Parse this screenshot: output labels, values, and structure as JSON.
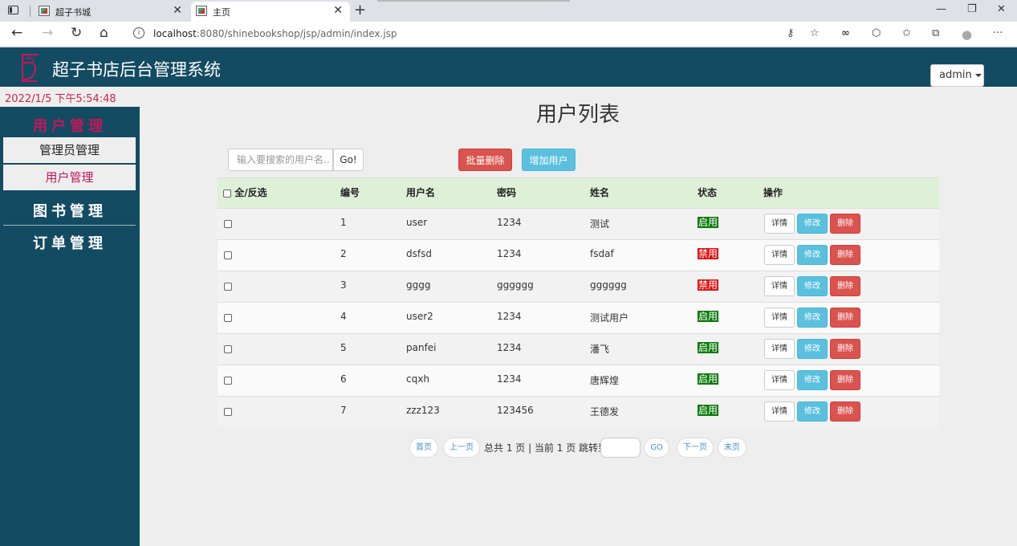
{
  "browser": {
    "tabs": [
      {
        "title": "超子书城",
        "active": false
      },
      {
        "title": "主页",
        "active": true
      }
    ],
    "url_host": "localhost",
    "url_rest": ":8080/shinebookshop/jsp/admin/index.jsp"
  },
  "header": {
    "title": "超子书店后台管理系统",
    "user_menu": "admin"
  },
  "sidebar": {
    "datetime": "2022/1/5 下午5:54:48",
    "sections": [
      {
        "label": "用户管理",
        "items": [
          "管理员管理",
          "用户管理"
        ]
      },
      {
        "label": "图书管理"
      },
      {
        "label": "订单管理"
      }
    ]
  },
  "main": {
    "title": "用户列表",
    "search_placeholder": "输入要搜索的用户名..",
    "go_label": "Go!",
    "batch_delete_label": "批量删除",
    "add_user_label": "增加用户",
    "columns": [
      "全/反选",
      "编号",
      "用户名",
      "密码",
      "姓名",
      "状态",
      "操作"
    ],
    "rows": [
      {
        "id": "1",
        "username": "user",
        "password": "1234",
        "name": "测试",
        "status": "启用"
      },
      {
        "id": "2",
        "username": "dsfsd",
        "password": "1234",
        "name": "fsdaf",
        "status": "禁用"
      },
      {
        "id": "3",
        "username": "gggg",
        "password": "gggggg",
        "name": "gggggg",
        "status": "禁用"
      },
      {
        "id": "4",
        "username": "user2",
        "password": "1234",
        "name": "测试用户",
        "status": "启用"
      },
      {
        "id": "5",
        "username": "panfei",
        "password": "1234",
        "name": "潘飞",
        "status": "启用"
      },
      {
        "id": "6",
        "username": "cqxh",
        "password": "1234",
        "name": "唐辉煌",
        "status": "启用"
      },
      {
        "id": "7",
        "username": "zzz123",
        "password": "123456",
        "name": "王德发",
        "status": "启用"
      }
    ],
    "row_actions": {
      "detail": "详情",
      "edit": "修改",
      "delete": "删除"
    },
    "status_colors": {
      "启用": "#0a7a0a",
      "禁用": "#e01010"
    },
    "pager": {
      "first": "首页",
      "prev": "上一页",
      "info": "总共 1 页 | 当前 1 页 跳转到",
      "go": "GO",
      "next": "下一页",
      "last": "末页"
    }
  }
}
